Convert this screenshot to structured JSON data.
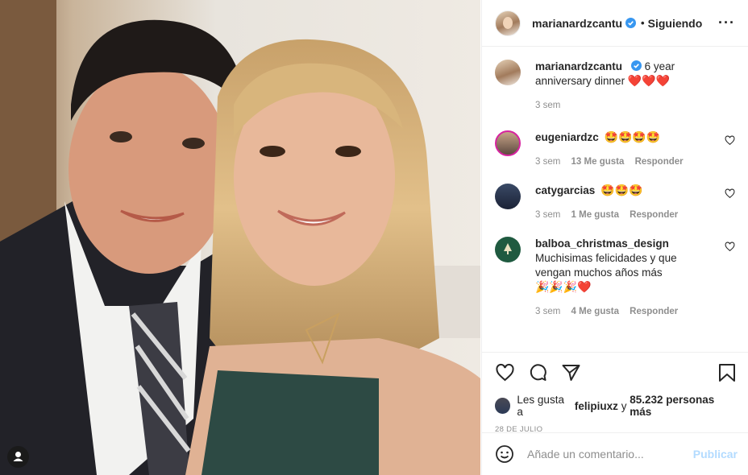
{
  "post": {
    "author": "marianardzcantu",
    "follow_state": "Siguiendo",
    "more_icon": "more-options-icon",
    "caption_text": "6 year anniversary dinner",
    "caption_emoji": "❤️❤️❤️",
    "caption_time": "3 sem"
  },
  "comments": [
    {
      "user": "eugeniardzc",
      "text": "🤩🤩🤩🤩",
      "time": "3 sem",
      "likes": "13 Me gusta",
      "reply": "Responder"
    },
    {
      "user": "catygarcias",
      "text": "🤩🤩🤩",
      "time": "3 sem",
      "likes": "1 Me gusta",
      "reply": "Responder"
    },
    {
      "user": "balboa_christmas_design",
      "text": "Muchisimas felicidades y que vengan muchos años más",
      "emoji": "🎉🎉🎉❤️",
      "time": "3 sem",
      "likes": "4 Me gusta",
      "reply": "Responder"
    }
  ],
  "likes": {
    "prefix": "Les gusta a",
    "user": "felipiuxz",
    "connector": "y",
    "count": "85.232 personas más"
  },
  "date": "28 DE JULIO",
  "add_comment": {
    "placeholder": "Añade un comentario...",
    "publish": "Publicar"
  },
  "colors": {
    "verified": "#3897f0",
    "heart": "#ed4956",
    "publish": "#b3dbff",
    "muted": "#8e8e8e"
  }
}
